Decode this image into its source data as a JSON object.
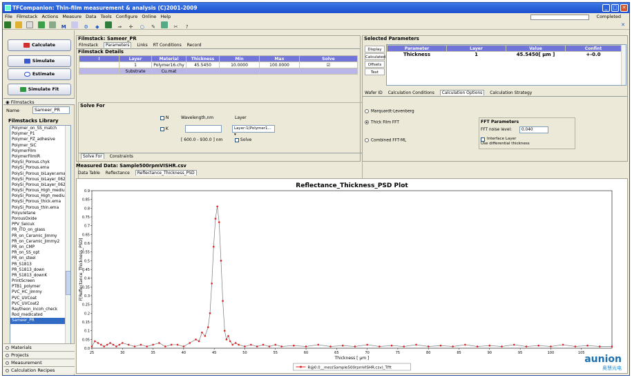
{
  "window": {
    "title": "TFCompanion: Thin-film measurement & analysis (C)2001-2009",
    "status": "Completed"
  },
  "menu": [
    "File",
    "Filmstack",
    "Actions",
    "Measure",
    "Data",
    "Tools",
    "Configure",
    "Online",
    "Help"
  ],
  "toolbar_icons": [
    "save-icon",
    "open-icon",
    "new-icon",
    "chart-icon",
    "grid-icon",
    "m-icon",
    "tool-icon",
    "gear-icon",
    "info-icon",
    "table-icon",
    "arrow-icon",
    "move-icon",
    "circle-icon",
    "brush-icon",
    "bar-icon",
    "wrench-icon",
    "help-icon"
  ],
  "actions": {
    "calculate": "Calculate",
    "simulate": "Simulate",
    "estimate": "Estimate",
    "simulate_fit": "Simulate Fit"
  },
  "filmstacks_tab": "Filmstacks",
  "name_label": "Name",
  "name_value": "Sameer_PR",
  "library": {
    "title": "Filmstacks Library",
    "items": [
      "Polymer_on_SS_match",
      "Polymer_P1",
      "Polymer_PZ_adhesive",
      "Polymer_SiC",
      "PolymerFilm",
      "PolymerFilmIR",
      "PolySi_Porous.chyk",
      "PolySi_Porous.ema",
      "PolySi_Porous_biLayer.ema",
      "PolySi_Porous_biLayer_062",
      "PolySi_Porous_biLayer_062",
      "PolySi_Porous_High_mediun",
      "PolySi_Porous_High_mediun",
      "PolySi_Porous_thick.ema",
      "PolySi_Porous_thin.ema",
      "Polyuretane",
      "PorousOxide",
      "PPV_Selcuk",
      "PR_ITO_on_glass",
      "PR_on_Ceramic_Jimmy",
      "PR_on_Ceramic_Jimmy2",
      "PR_on_CMP",
      "PR_on_SS_opt",
      "PR_on_steel",
      "PR_S1813",
      "PR_S1813_down",
      "PR_S1813_downK",
      "PrintScreen",
      "PTB1_polymer",
      "PVC_HC_jimmy",
      "PVC_UVCoat",
      "PVC_UVCoat2",
      "Raytheon_incoh_check",
      "Rod_medicated",
      "Sameer_PR"
    ],
    "selected": "Sameer_PR"
  },
  "bottom_tabs": [
    "Materials",
    "Projects",
    "Measurement",
    "Calculation Recipes"
  ],
  "filmstack": {
    "title": "Filmstack: Sameer_PR",
    "tabs": [
      "Filmstack",
      "Parameters",
      "Links",
      "RT Conditions",
      "Record"
    ],
    "details": "Filmstack Details",
    "columns": [
      "!",
      "Layer",
      "Material",
      "Thickness",
      "Min",
      "Max",
      "Solve"
    ],
    "rows": [
      {
        "layer": "1",
        "material": "Polymer16.chy",
        "thickness": "45.5450",
        "min": "10.0000",
        "max": "100.0000"
      },
      {
        "layer": "Substrate",
        "material": "Cu.mat"
      }
    ]
  },
  "solve": {
    "title": "Solve For",
    "n": "N",
    "k": "K",
    "wl_label": "Wavelength,nm",
    "layer_label": "Layer",
    "layer_value": "Layer:1(Polymer1...",
    "range": "[ 600.0 - 930.0 ] nm",
    "solve": "Solve",
    "tabs": [
      "Solve For",
      "Constraints"
    ]
  },
  "selected_params": {
    "title": "Selected Parameters",
    "side": [
      "Display",
      "Calculated",
      "Offsets",
      "Text"
    ],
    "columns": [
      "Parameter",
      "Layer",
      "Value",
      "Confint"
    ],
    "row": {
      "parameter": "Thickness",
      "layer": "1",
      "value": "45.5450[ µm ]",
      "confint": "+-0.0"
    }
  },
  "calc_tabs": [
    "Wafer ID",
    "Calculation Conditions",
    "Calculation Options",
    "Calculation Strategy"
  ],
  "calc_options": {
    "opt1": "Marquardt-Levenberg",
    "opt2": "Thick Film FFT",
    "opt3": "Combined FFT-ML",
    "fft_title": "FFT Parameters",
    "noise_label": "FFT noise level:",
    "noise_value": "0.040",
    "interface": "Interface Layer",
    "differential": "Use differential thickness"
  },
  "measured": {
    "title": "Measured Data: Sample500rpmVISHR.csv",
    "tabs": [
      "Data Table",
      "Reflectance",
      "Reflectance_Thickness_PSD"
    ]
  },
  "brand": {
    "name": "aunion",
    "sub": "奥慧光电"
  },
  "chart_data": {
    "type": "line",
    "title": "Reflectance_Thickness_PSD Plot",
    "xlabel": "Thickness [ µm ]",
    "ylabel": "F[Reflectance_Thickness_PSD]",
    "xlim": [
      25,
      110
    ],
    "ylim": [
      0,
      0.9
    ],
    "xticks": [
      25,
      30,
      35,
      40,
      45,
      50,
      55,
      60,
      65,
      70,
      75,
      80,
      85,
      90,
      95,
      100,
      105
    ],
    "yticks": [
      0,
      0.05,
      0.1,
      0.15,
      0.2,
      0.25,
      0.3,
      0.35,
      0.4,
      0.45,
      0.5,
      0.55,
      0.6,
      0.65,
      0.7,
      0.75,
      0.8,
      0.85,
      0.9
    ],
    "ytick_labels": [
      "0.0",
      "0.05",
      "0.1",
      "0.15",
      "0.2",
      "0.25",
      "0.3",
      "0.35",
      "0.4",
      "0.45",
      "0.5",
      "0.55",
      "0.6",
      "0.65",
      "0.7",
      "0.75",
      "0.8",
      "0.85",
      "0.9"
    ],
    "series": [
      {
        "name": "R@0.0__mes(Sample500rpmVISHR.csv)_Tfft",
        "color": "#e02020",
        "x": [
          25,
          25.5,
          26,
          26.5,
          27,
          27.5,
          28,
          28.5,
          29,
          29.5,
          30,
          31,
          32,
          33,
          34,
          35,
          36,
          37,
          38,
          39,
          40,
          41,
          42,
          42.5,
          43,
          43.5,
          44,
          44.3,
          44.6,
          44.9,
          45.2,
          45.5,
          45.8,
          46.1,
          46.4,
          46.7,
          47,
          47.3,
          47.6,
          48,
          48.5,
          49,
          50,
          51,
          52,
          53,
          54,
          55,
          56,
          58,
          60,
          62,
          64,
          66,
          68,
          70,
          72,
          74,
          76,
          78,
          80,
          82,
          84,
          86,
          88,
          90,
          92,
          94,
          96,
          98,
          100,
          102,
          104,
          106,
          108,
          110
        ],
        "y": [
          0.01,
          0.04,
          0.03,
          0.02,
          0.01,
          0.02,
          0.03,
          0.02,
          0.01,
          0.02,
          0.03,
          0.02,
          0.01,
          0.02,
          0.01,
          0.02,
          0.03,
          0.01,
          0.02,
          0.02,
          0.01,
          0.03,
          0.05,
          0.04,
          0.09,
          0.07,
          0.12,
          0.2,
          0.37,
          0.58,
          0.74,
          0.81,
          0.72,
          0.5,
          0.27,
          0.1,
          0.05,
          0.07,
          0.04,
          0.02,
          0.03,
          0.02,
          0.01,
          0.02,
          0.01,
          0.02,
          0.01,
          0.02,
          0.01,
          0.015,
          0.01,
          0.02,
          0.01,
          0.015,
          0.01,
          0.02,
          0.01,
          0.015,
          0.01,
          0.02,
          0.01,
          0.015,
          0.01,
          0.02,
          0.01,
          0.015,
          0.01,
          0.02,
          0.01,
          0.015,
          0.01,
          0.02,
          0.01,
          0.015,
          0.01,
          0.01
        ]
      }
    ]
  }
}
